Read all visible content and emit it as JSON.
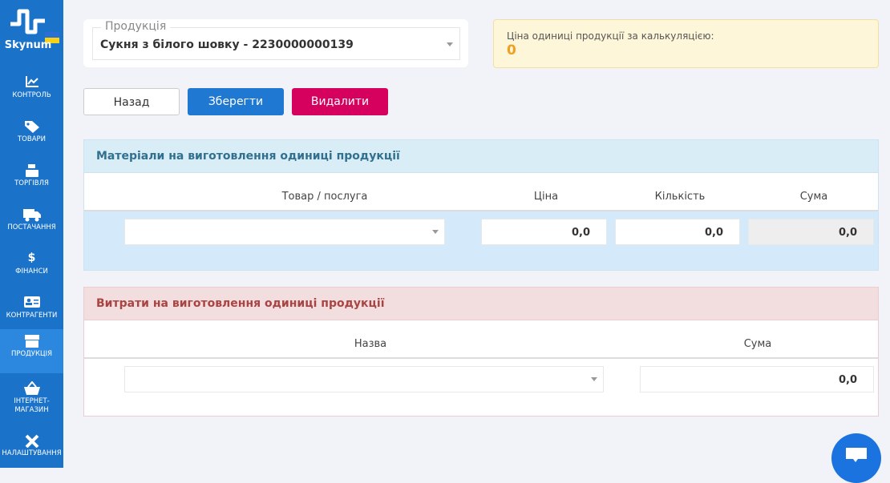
{
  "sidebar": {
    "brand": "Skynum",
    "items": [
      {
        "label": "КОНТРОЛЬ",
        "icon": "chart-icon"
      },
      {
        "label": "ТОВАРИ",
        "icon": "tags-icon"
      },
      {
        "label": "ТОРГІВЛЯ",
        "icon": "cash-register-icon"
      },
      {
        "label": "ПОСТАЧАННЯ",
        "icon": "truck-icon"
      },
      {
        "label": "ФІНАНСИ",
        "icon": "hand-dollar-icon"
      },
      {
        "label": "КОНТРАГЕНТИ",
        "icon": "id-card-icon"
      },
      {
        "label": "ПРОДУКЦІЯ",
        "icon": "box-icon",
        "active": true
      },
      {
        "label": "ІНТЕРНЕТ-МАГАЗИН",
        "icon": "basket-icon"
      },
      {
        "label": "НАЛАШТУВАННЯ",
        "icon": "tools-icon"
      }
    ]
  },
  "product": {
    "legend": "Продукція",
    "value": "Сукня з білого шовку - 2230000000139"
  },
  "unit_price": {
    "label": "Ціна одиниці продукції за калькуляцією:",
    "value": "0"
  },
  "buttons": {
    "back": "Назад",
    "save": "Зберегти",
    "delete": "Видалити"
  },
  "materials": {
    "title": "Матеріали на виготовлення одиниці продукції",
    "columns": [
      "Товар / послуга",
      "Ціна",
      "Кількість",
      "Сума"
    ],
    "row": {
      "item": "",
      "price": "0,0",
      "qty": "0,0",
      "sum": "0,0"
    }
  },
  "expenses": {
    "title": "Витрати на виготовлення одиниці продукції",
    "columns": [
      "Назва",
      "Сума"
    ],
    "row": {
      "name": "",
      "sum": "0,0"
    }
  },
  "colors": {
    "sidebar": "#1b73c9",
    "save": "#1f78d1",
    "delete": "#d6005f"
  }
}
